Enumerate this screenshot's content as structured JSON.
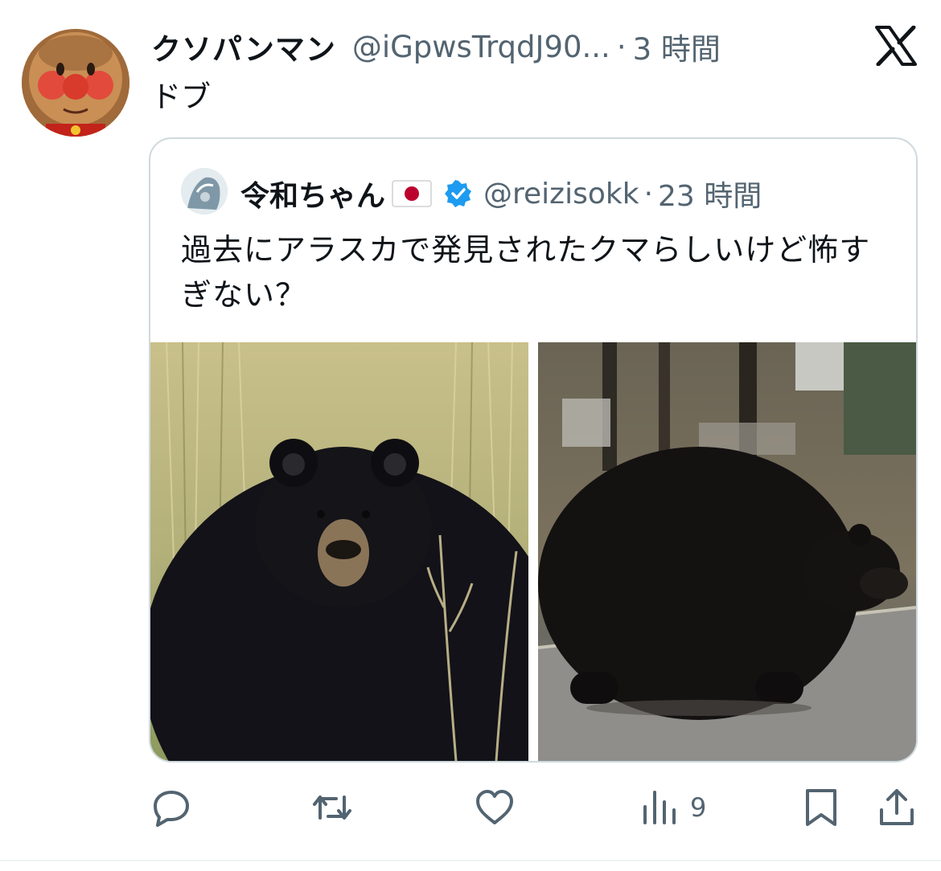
{
  "tweet": {
    "display_name": "クソパンマン",
    "handle": "@iGpwsTrqdJ90...",
    "separator": "·",
    "time": "3 時間",
    "text": "ドブ",
    "avatar_icon": "anpanman-avatar"
  },
  "quote": {
    "display_name": "令和ちゃん",
    "flag_icon": "japan-flag-icon",
    "verified_icon": "verified-badge-icon",
    "handle": "@reizisokk",
    "separator": "·",
    "time": "23 時間",
    "text": "過去にアラスカで発見されたクマらしいけど怖すぎない？",
    "photos": [
      {
        "icon": "bear-front-photo"
      },
      {
        "icon": "bear-side-photo"
      }
    ]
  },
  "actions": {
    "reply_icon": "reply-icon",
    "retweet_icon": "retweet-icon",
    "like_icon": "like-icon",
    "views_icon": "views-icon",
    "views_count": "9",
    "bookmark_icon": "bookmark-icon",
    "share_icon": "share-icon"
  },
  "brand": {
    "logo_icon": "x-logo-icon"
  },
  "colors": {
    "text_primary": "#0f1419",
    "text_secondary": "#536471",
    "border": "#cfd9de",
    "verified_blue": "#1d9bf0"
  }
}
